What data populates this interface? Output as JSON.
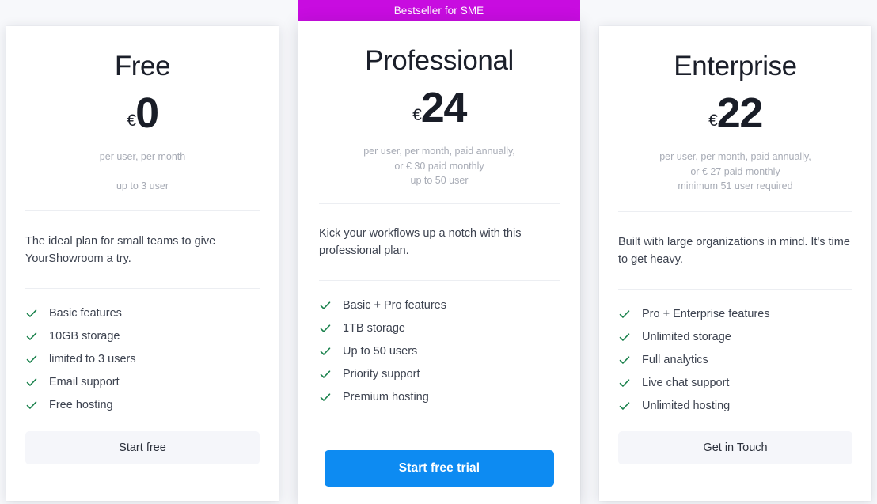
{
  "page": {
    "background_color": "#f7f8fb",
    "accent_primary": "#0d8bf2",
    "accent_ribbon": "#c80ce0",
    "check_color": "#17804a"
  },
  "plans": [
    {
      "id": "free",
      "name": "Free",
      "currency": "€",
      "amount": "0",
      "note_line_1": "per user, per month",
      "note_line_2": "",
      "note_line_3": "up to 3 user",
      "blurb": "The ideal plan for small teams to give YourShowroom a try.",
      "features": [
        "Basic features",
        "10GB storage",
        "limited to 3 users",
        "Email support",
        "Free hosting"
      ],
      "cta_label": "Start free"
    },
    {
      "id": "professional",
      "name": "Professional",
      "ribbon_label": "Bestseller for SME",
      "currency": "€",
      "amount": "24",
      "note_line_1": "per user, per month, paid annually,",
      "note_line_2": "or € 30 paid monthly",
      "note_line_3": "up to 50 user",
      "blurb": "Kick your workflows up a notch with this professional plan.",
      "features": [
        "Basic + Pro features",
        "1TB storage",
        "Up to 50 users",
        "Priority support",
        "Premium hosting"
      ],
      "cta_label": "Start free trial"
    },
    {
      "id": "enterprise",
      "name": "Enterprise",
      "currency": "€",
      "amount": "22",
      "note_line_1": "per user, per month, paid annually,",
      "note_line_2": "or € 27 paid monthly",
      "note_line_3": "minimum 51 user required",
      "blurb": "Built with large organizations in mind. It's time to get heavy.",
      "features": [
        "Pro + Enterprise features",
        "Unlimited storage",
        "Full analytics",
        "Live chat support",
        "Unlimited hosting"
      ],
      "cta_label": "Get in Touch"
    }
  ],
  "icons": {
    "check": "check-icon"
  }
}
